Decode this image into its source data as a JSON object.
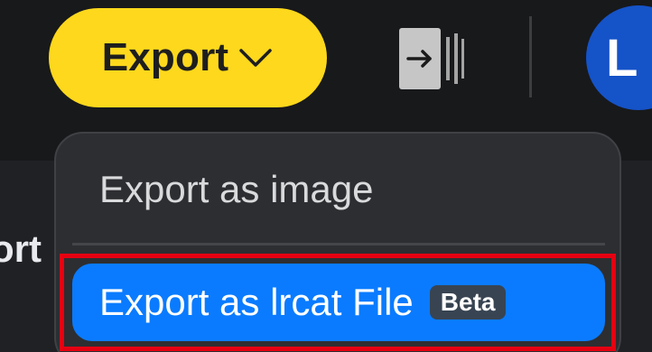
{
  "toolbar": {
    "export_label": "Export",
    "avatar_initial": "L",
    "export_color": "#fed81c",
    "avatar_color": "#1553c8"
  },
  "background_text": "ort",
  "export_menu": {
    "items": [
      {
        "label": "Export as image"
      },
      {
        "label": "Export as lrcat File",
        "badge": "Beta",
        "selected": true
      }
    ],
    "selected_color": "#0a7bff",
    "highlight_frame_color": "#e60011"
  },
  "icons": [
    "chevron-down-icon",
    "panel-collapse-icon"
  ]
}
